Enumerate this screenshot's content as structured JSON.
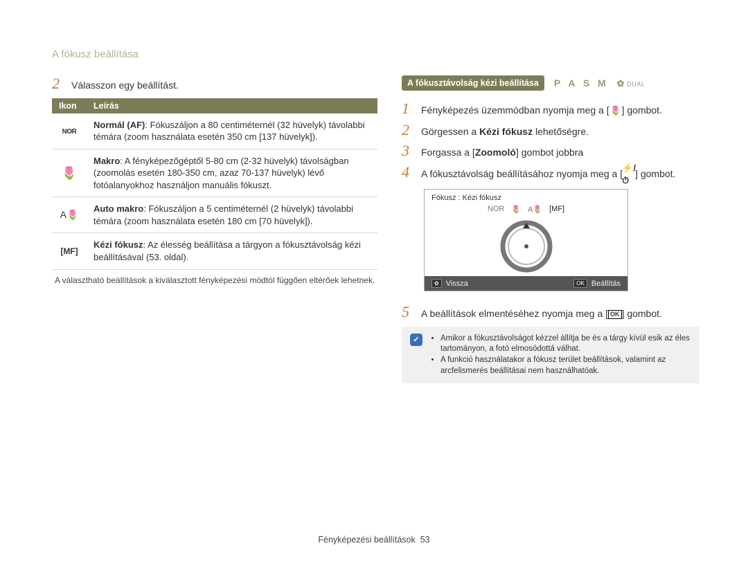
{
  "page_title": "A fókusz beállítása",
  "left": {
    "step2_num": "2",
    "step2_text": "Válasszon egy beállítást.",
    "table": {
      "head_icon": "Ikon",
      "head_desc": "Leírás",
      "rows": [
        {
          "icon": "NOR",
          "bold": "Normál (AF)",
          "text": ": Fókuszáljon a 80 centiméternél (32 hüvelyk) távolabbi témára (zoom használata esetén 350 cm [137 hüvelyk])."
        },
        {
          "icon": "🌷",
          "bold": "Makro",
          "text": ": A fényképezőgéptől 5-80 cm (2-32 hüvelyk) távolságban (zoomolás esetén 180-350 cm, azaz 70-137 hüvelyk) lévő fotóalanyokhoz használjon manuális fókuszt."
        },
        {
          "icon": "A🌷",
          "bold": "Auto makro",
          "text": ": Fókuszáljon a 5 centiméternél (2 hüvelyk) távolabbi témára (zoom használata esetén 180 cm [70 hüvelyk])."
        },
        {
          "icon": "[MF]",
          "bold": "Kézi fókusz",
          "text": ": Az élesség beállítása a tárgyon a fókusztávolság kézi beállításával (53. oldal)."
        }
      ]
    },
    "footnote": "A választható beállítások a kiválasztott fényképezési módtól függően eltérőek lehetnek."
  },
  "right": {
    "subhead_badge": "A fókusztávolság kézi beállítása",
    "mode_letters": "P A S M",
    "mode_dual": "DUAL",
    "steps": [
      {
        "num": "1",
        "pre": "Fényképezés üzemmódban nyomja meg a [",
        "icon": "🌷",
        "post": "] gombot."
      },
      {
        "num": "2",
        "rich": true,
        "a": "Görgessen a ",
        "b": "Kézi fókusz",
        "c": " lehetőségre."
      },
      {
        "num": "3",
        "rich": true,
        "a": "Forgassa a [",
        "b": "Zoomoló",
        "c": "] gombot jobbra"
      },
      {
        "num": "4",
        "pre": "A fókusztávolság beállításához nyomja meg a [",
        "icon": "⚡/⏱",
        "post": "] gombot."
      }
    ],
    "camera": {
      "top_label": "Fókusz : Kézi fókusz",
      "iconrow": [
        "NOR",
        "🌷",
        "A🌷",
        "[MF]"
      ],
      "back": "Vissza",
      "set": "Beállítás",
      "back_icon": "✿",
      "set_icon": "OK"
    },
    "step5": {
      "num": "5",
      "pre": "A beállítások elmentéséhez nyomja meg a [",
      "ok": "OK",
      "post": "] gombot."
    },
    "infobox": [
      "Amikor a fókusztávolságot kézzel állítja be és a tárgy kívül esik az éles tartományon, a fotó elmosódottá válhat.",
      "A funkció használatakor a fókusz terület beállítások, valamint az arcfelismerés beállításai nem használhatóak."
    ]
  },
  "footer": {
    "section": "Fényképezési beállítások",
    "page": "53"
  }
}
